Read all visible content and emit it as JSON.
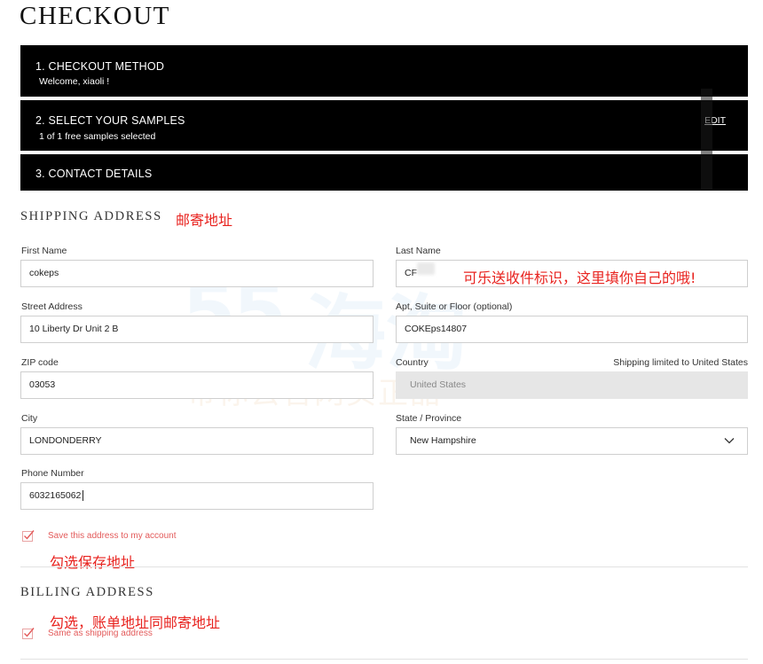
{
  "page": {
    "title": "CHECKOUT"
  },
  "steps": [
    {
      "title": "1. CHECKOUT METHOD",
      "subtitle": "Welcome, xiaoli !"
    },
    {
      "title": "2. SELECT YOUR SAMPLES",
      "subtitle": "1 of 1 free samples selected",
      "action": "EDIT"
    },
    {
      "title": "3. CONTACT DETAILS"
    }
  ],
  "shipping": {
    "heading": "SHIPPING ADDRESS",
    "annotation": "邮寄地址",
    "first_name": {
      "label": "First Name",
      "value": "cokeps"
    },
    "last_name": {
      "label": "Last Name",
      "value": "CF",
      "annotation": "可乐送收件标识，这里填你自己的哦!"
    },
    "street": {
      "label": "Street Address",
      "value": "10 Liberty Dr Unit 2 B"
    },
    "apt": {
      "label": "Apt, Suite or Floor (optional)",
      "value": "COKEps14807"
    },
    "zip": {
      "label": "ZIP code",
      "value": "03053"
    },
    "country": {
      "label": "Country",
      "value": "United States",
      "hint": "Shipping limited to United States"
    },
    "city": {
      "label": "City",
      "value": "LONDONDERRY"
    },
    "state": {
      "label": "State / Province",
      "value": "New Hampshire"
    },
    "phone": {
      "label": "Phone Number",
      "value": "6032165062"
    },
    "save_address": {
      "label": "Save this address to my account",
      "checked": true,
      "annotation": "勾选保存地址"
    }
  },
  "billing": {
    "heading": "BILLING ADDRESS",
    "same_as_shipping": {
      "label": "Same as shipping address",
      "checked": true,
      "annotation": "勾选，账单地址同邮寄地址"
    }
  },
  "watermark": {
    "number": "55",
    "brand": "海淘",
    "tagline": "带你去官网买正品"
  },
  "colors": {
    "step_bg": "#000000",
    "annotation": "#e8231f",
    "check": "#e35a5a",
    "disabled_bg": "#e6e6e6"
  }
}
